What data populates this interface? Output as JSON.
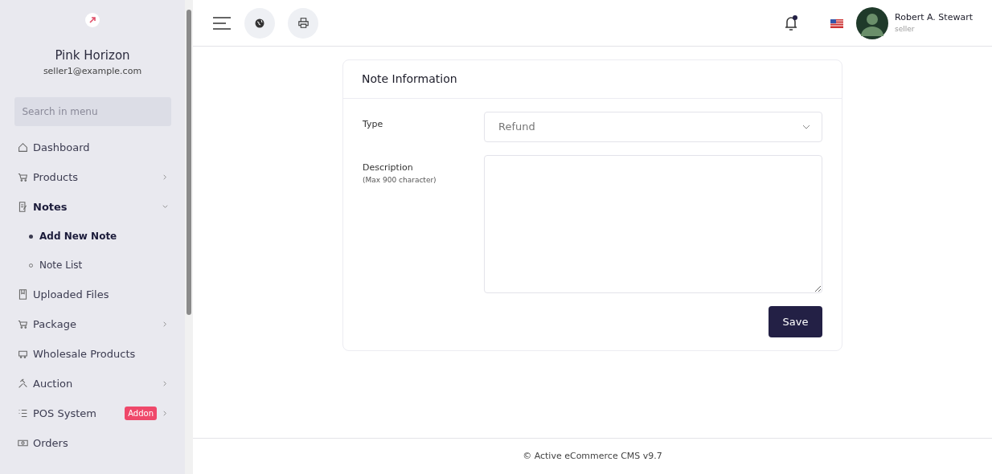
{
  "sidebar": {
    "shop_name": "Pink Horizon",
    "email": "seller1@example.com",
    "search": {
      "placeholder": "Search in menu"
    },
    "items": [
      {
        "label": "Dashboard",
        "selected": false
      },
      {
        "label": "Products",
        "expanded": false,
        "selected": false
      },
      {
        "label": "Notes",
        "expanded": true,
        "selected": true,
        "children": [
          {
            "label": "Add New Note",
            "selected": true
          },
          {
            "label": "Note List",
            "selected": false
          }
        ]
      },
      {
        "label": "Uploaded Files",
        "selected": false
      },
      {
        "label": "Package",
        "expanded": false,
        "selected": false
      },
      {
        "label": "Wholesale Products",
        "selected": false
      },
      {
        "label": "Auction",
        "expanded": false,
        "selected": false
      },
      {
        "label": "POS System",
        "expanded": false,
        "selected": false,
        "badge": "Addon"
      },
      {
        "label": "Orders",
        "selected": false
      }
    ]
  },
  "topbar": {
    "notification_dot": true,
    "user": {
      "name": "Robert A. Stewart",
      "role": "seller"
    }
  },
  "form": {
    "title": "Note Information",
    "fields": [
      {
        "kind": "select",
        "label": "Type",
        "value": "Refund"
      },
      {
        "kind": "textarea",
        "label": "Description",
        "hint": "(Max 900 character)"
      }
    ],
    "button": "Save"
  },
  "footer": "© Active eCommerce CMS v9.7"
}
